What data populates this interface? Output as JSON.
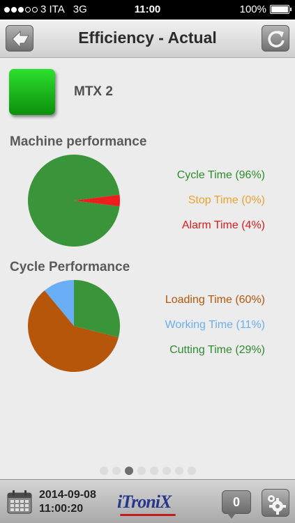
{
  "status_bar": {
    "carrier": "3 ITA",
    "network": "3G",
    "time": "11:00",
    "battery": "100%",
    "signal_bars_filled": 3,
    "signal_bars_total": 5
  },
  "nav": {
    "title": "Efficiency - Actual",
    "back_icon": "back-arrow-icon",
    "refresh_icon": "refresh-icon"
  },
  "machine": {
    "name": "MTX 2",
    "status_color": "#1fbf1f"
  },
  "machine_performance": {
    "title": "Machine performance",
    "legend": [
      {
        "label": "Cycle Time (96%)",
        "color": "#2e8b2e"
      },
      {
        "label": "Stop Time (0%)",
        "color": "#f0a030"
      },
      {
        "label": "Alarm Time (4%)",
        "color": "#e01b1b"
      }
    ]
  },
  "cycle_performance": {
    "title": "Cycle Performance",
    "legend": [
      {
        "label": "Loading Time (60%)",
        "color": "#b5560a"
      },
      {
        "label": "Working Time (11%)",
        "color": "#6aaef5"
      },
      {
        "label": "Cutting Time (29%)",
        "color": "#2e8b2e"
      }
    ]
  },
  "chart_data": [
    {
      "type": "pie",
      "title": "Machine performance",
      "categories": [
        "Cycle Time",
        "Stop Time",
        "Alarm Time"
      ],
      "values": [
        96,
        0,
        4
      ],
      "colors": [
        "#3a943a",
        "#f0a030",
        "#ee1e1e"
      ]
    },
    {
      "type": "pie",
      "title": "Cycle Performance",
      "categories": [
        "Loading Time",
        "Working Time",
        "Cutting Time"
      ],
      "values": [
        60,
        11,
        29
      ],
      "colors": [
        "#b5560a",
        "#6aaef5",
        "#3a943a"
      ]
    }
  ],
  "pager": {
    "total": 8,
    "active": 3
  },
  "bottom": {
    "date": "2014-09-08",
    "time": "11:00:20",
    "logo": "iTroniX",
    "notifications": "0",
    "calendar_icon": "calendar-icon",
    "settings_icon": "gears-icon"
  }
}
